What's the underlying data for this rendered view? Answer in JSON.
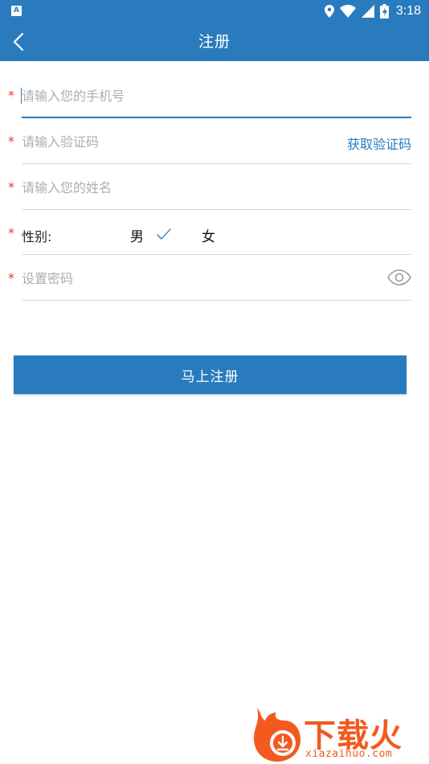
{
  "status_bar": {
    "time": "3:18",
    "notification_icon": "a-icon",
    "icons": [
      "location-icon",
      "wifi-icon",
      "signal-icon",
      "battery-icon"
    ]
  },
  "header": {
    "title": "注册",
    "back_icon": "chevron-left-icon"
  },
  "form": {
    "required_mark": "*",
    "phone": {
      "placeholder": "请输入您的手机号",
      "value": ""
    },
    "code": {
      "placeholder": "请输入验证码",
      "value": "",
      "action_label": "获取验证码"
    },
    "name": {
      "placeholder": "请输入您的姓名",
      "value": ""
    },
    "gender": {
      "label": "性别:",
      "options": [
        "男",
        "女"
      ],
      "selected": "男"
    },
    "password": {
      "placeholder": "设置密码",
      "value": "",
      "toggle_icon": "eye-icon"
    }
  },
  "submit_label": "马上注册",
  "watermark": {
    "text": "下载火",
    "url": "xiazaihuo.com"
  },
  "colors": {
    "primary": "#2a7bbd",
    "required": "#e53935",
    "watermark": "#f25a1f"
  }
}
